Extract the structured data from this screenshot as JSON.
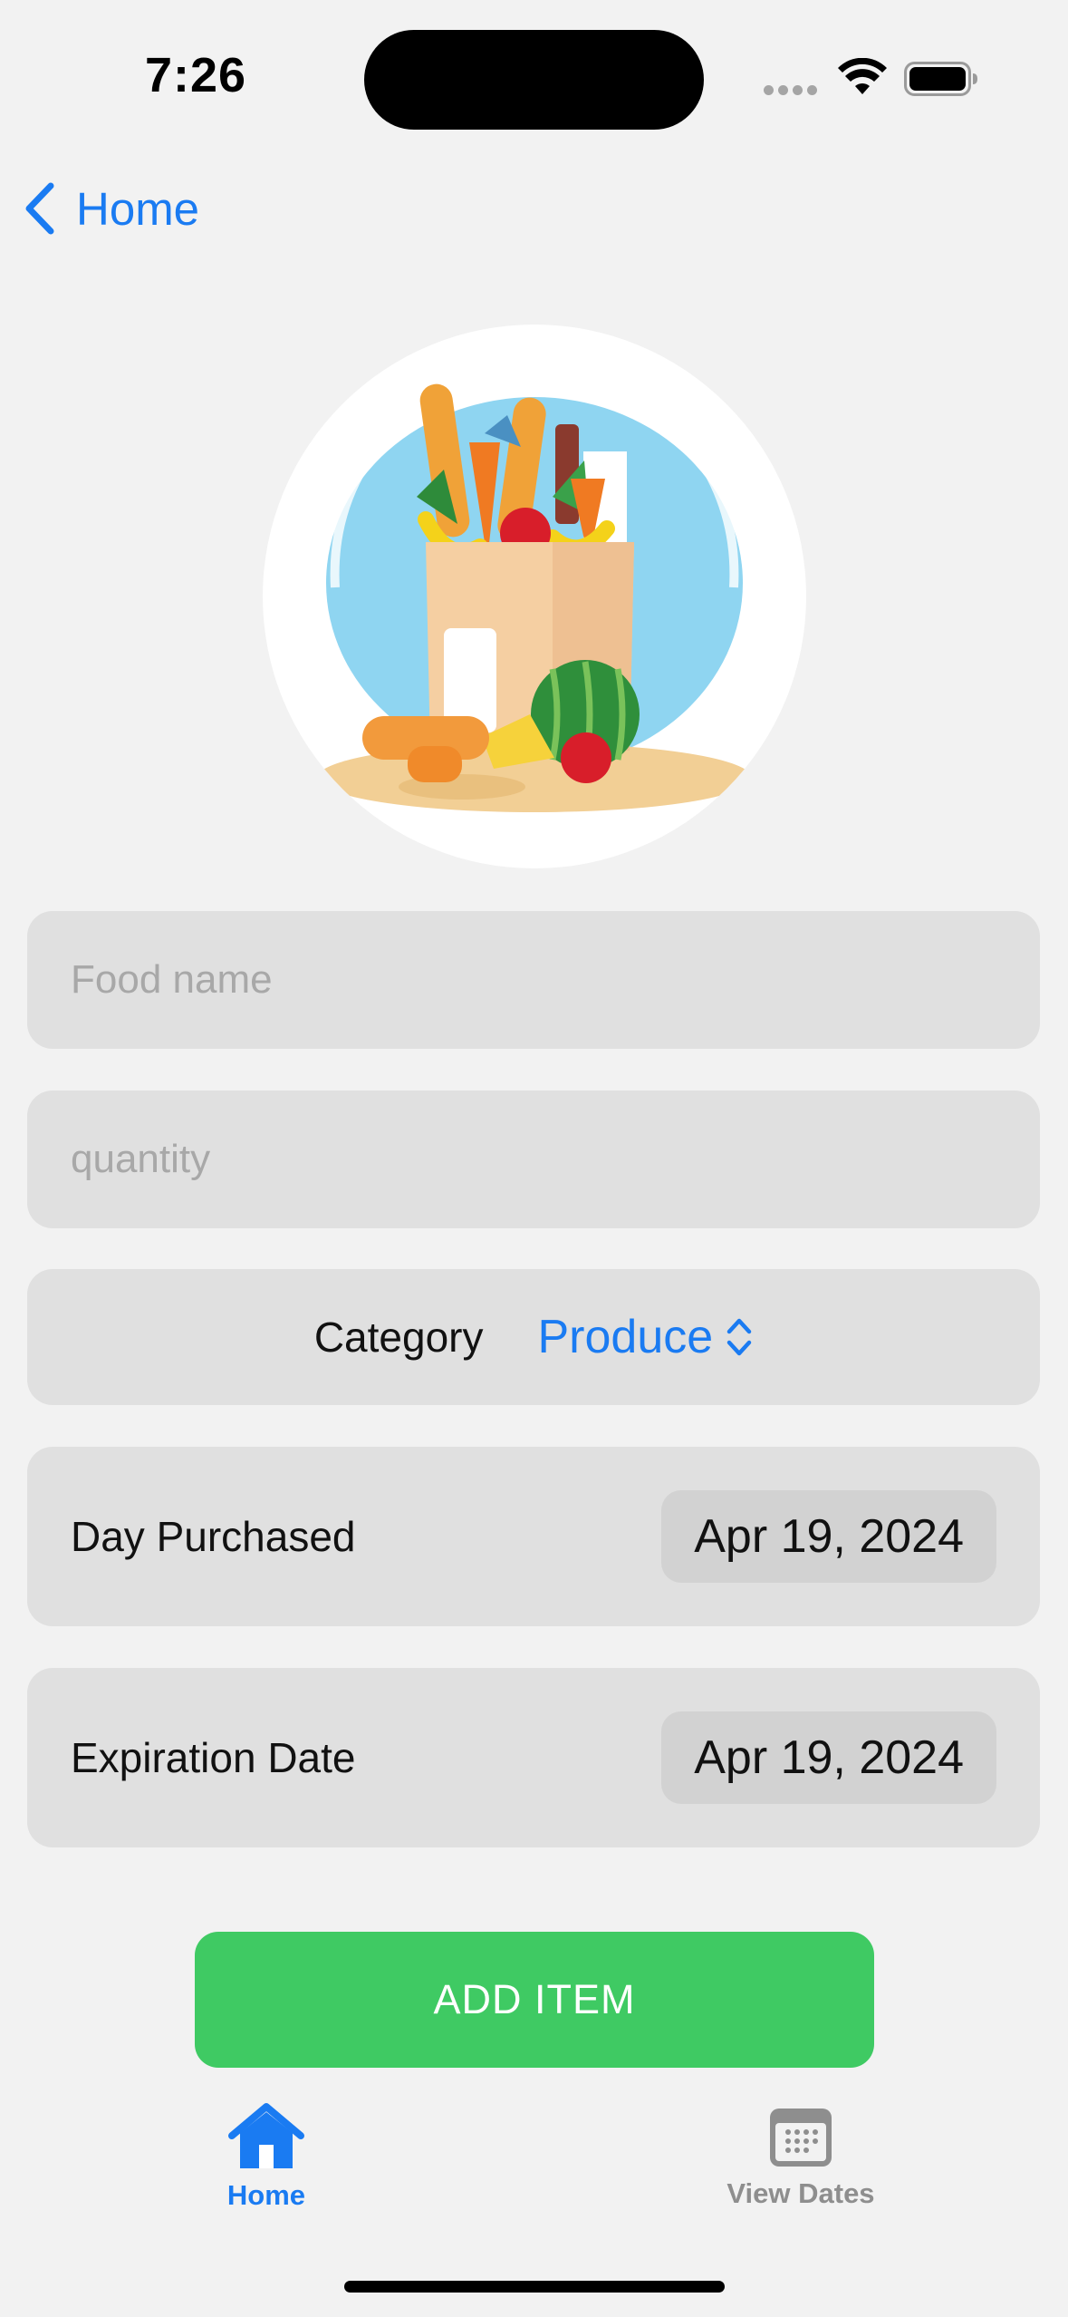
{
  "status_bar": {
    "time": "7:26"
  },
  "nav": {
    "back_label": "Home"
  },
  "form": {
    "food_name_placeholder": "Food name",
    "quantity_placeholder": "quantity",
    "category_label": "Category",
    "category_value": "Produce",
    "day_purchased_label": "Day Purchased",
    "day_purchased_value": "Apr 19, 2024",
    "expiration_label": "Expiration Date",
    "expiration_value": "Apr 19, 2024"
  },
  "add_button_label": "ADD ITEM",
  "tab_bar": {
    "home_label": "Home",
    "dates_label": "View Dates"
  },
  "colors": {
    "accent": "#1a7bf2",
    "button_green": "#3fca63",
    "field_bg": "#e0e0e0",
    "page_bg": "#f2f2f2"
  }
}
